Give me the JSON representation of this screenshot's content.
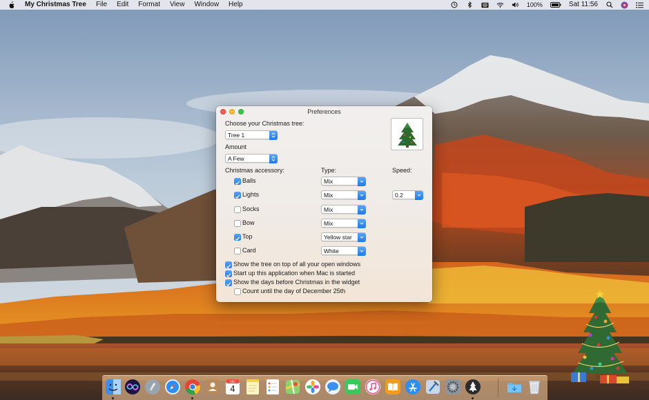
{
  "menubar": {
    "app_name": "My Christmas Tree",
    "menus": [
      "File",
      "Edit",
      "Format",
      "View",
      "Window",
      "Help"
    ],
    "battery": "100%",
    "clock": "Sat 11:56"
  },
  "window": {
    "title": "Preferences",
    "choose_tree_label": "Choose your Christmas tree:",
    "tree_value": "Tree 1",
    "amount_label": "Amount",
    "amount_value": "A Few",
    "accessory_label": "Christmas accessory:",
    "type_label": "Type:",
    "speed_label": "Speed:",
    "speed_value": "0.2",
    "accessories": [
      {
        "name": "Balls",
        "checked": true,
        "type": "Mix"
      },
      {
        "name": "Lights",
        "checked": true,
        "type": "Mix"
      },
      {
        "name": "Socks",
        "checked": false,
        "type": "Mix"
      },
      {
        "name": "Bow",
        "checked": false,
        "type": "Mix"
      },
      {
        "name": "Top",
        "checked": true,
        "type": "Yellow star"
      },
      {
        "name": "Card",
        "checked": false,
        "type": "White"
      }
    ],
    "options": [
      {
        "label": "Show the tree on top of all your open windows",
        "checked": true
      },
      {
        "label": "Start up this application when Mac is started",
        "checked": true
      },
      {
        "label": "Show the days before Christmas in the widget",
        "checked": true
      },
      {
        "label": "Count until the day of December 25th",
        "checked": false
      }
    ]
  },
  "dock": {
    "calendar_day": "4",
    "calendar_month": "DEC"
  },
  "colors": {
    "accent": "#2f86f0",
    "close": "#fc5b57",
    "minimize": "#fdbc2f",
    "zoom": "#33c748"
  }
}
